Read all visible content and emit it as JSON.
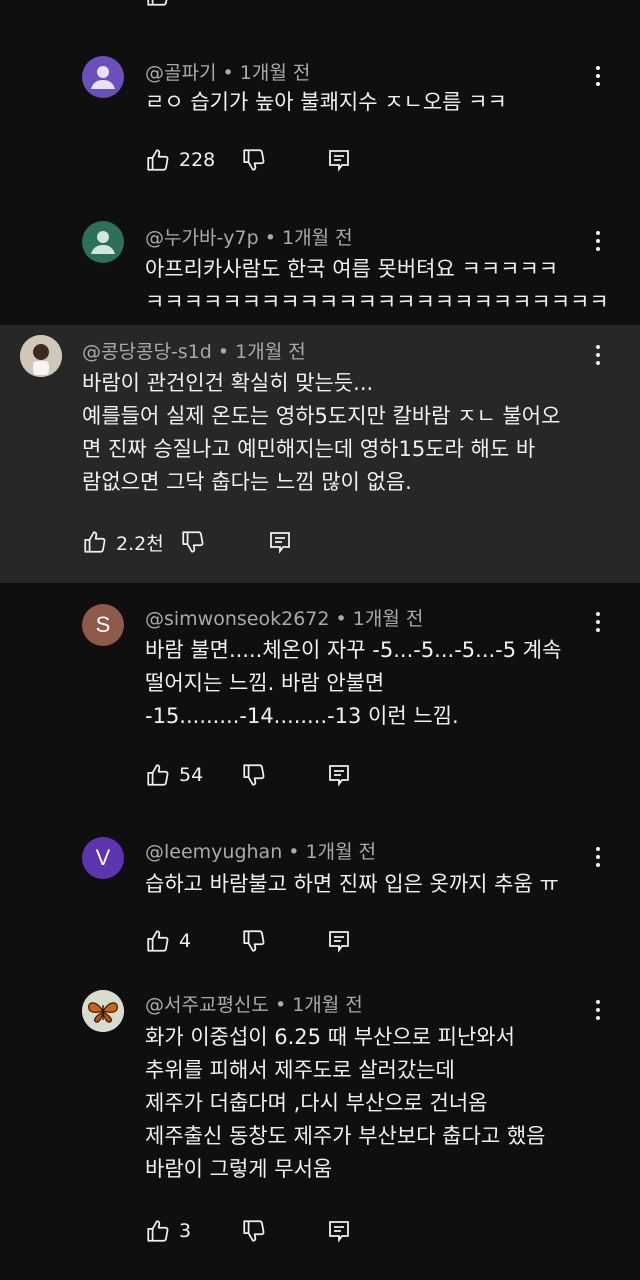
{
  "comments": [
    {
      "id": "c1",
      "handle": "@골파기",
      "time": "1개월 전",
      "avatar_text": "",
      "avatar_color": "#6b4fbb",
      "lines": [
        "ㄹㅇ 습기가 높아 불쾌지수 ㅈㄴ오름 ㅋㅋ"
      ],
      "likes": "228"
    },
    {
      "id": "c2",
      "handle": "@누가바-y7p",
      "time": "1개월 전",
      "avatar_text": "",
      "avatar_color": "#2e6f5a",
      "lines": [
        "아프리카사람도 한국 여름 못버텨요 ㅋㅋㅋㅋㅋ",
        "ㅋㅋㅋㅋㅋㅋㅋㅋㅋㅋㅋㅋㅋㅋㅋㅋㅋㅋㅋㅋㅋㅋㅋㅋ"
      ],
      "likes": ""
    },
    {
      "id": "c3",
      "handle": "@콩당콩당-s1d",
      "time": "1개월 전",
      "avatar_text": "",
      "avatar_color": "#d9d3c7",
      "lines": [
        "바람이 관건인건 확실히 맞는듯...",
        "예를들어 실제 온도는 영하5도지만 칼바람 ㅈㄴ 불어오",
        "면 진짜 승질나고 예민해지는데   영하15도라 해도 바",
        "람없으면 그닥 춥다는 느낌 많이 없음."
      ],
      "likes": "2.2천"
    },
    {
      "id": "c4",
      "handle": "@simwonseok2672",
      "time": "1개월 전",
      "avatar_text": "S",
      "avatar_color": "#8d5a4c",
      "lines": [
        "바람 불면.....체온이 자꾸 -5...-5...-5...-5 계속",
        "떨어지는 느낌. 바람 안불면",
        "-15.........-14........-13 이런 느낌."
      ],
      "likes": "54"
    },
    {
      "id": "c5",
      "handle": "@leemyughan",
      "time": "1개월 전",
      "avatar_text": "V",
      "avatar_color": "#5e35b1",
      "lines": [
        "습하고 바람불고 하면 진짜 입은 옷까지 추움 ㅠ"
      ],
      "likes": "4"
    },
    {
      "id": "c6",
      "handle": "@서주교평신도",
      "time": "1개월 전",
      "avatar_text": "",
      "avatar_color": "#d8dccf",
      "lines": [
        "화가 이중섭이 6.25 때 부산으로 피난와서",
        "추위를 피해서 제주도로 살러갔는데",
        "제주가 더춥다며 ,다시 부산으로 건너옴",
        "제주출신 동창도  제주가 부산보다 춥다고 했음",
        "바람이 그렇게 무서움"
      ],
      "likes": "3"
    }
  ]
}
